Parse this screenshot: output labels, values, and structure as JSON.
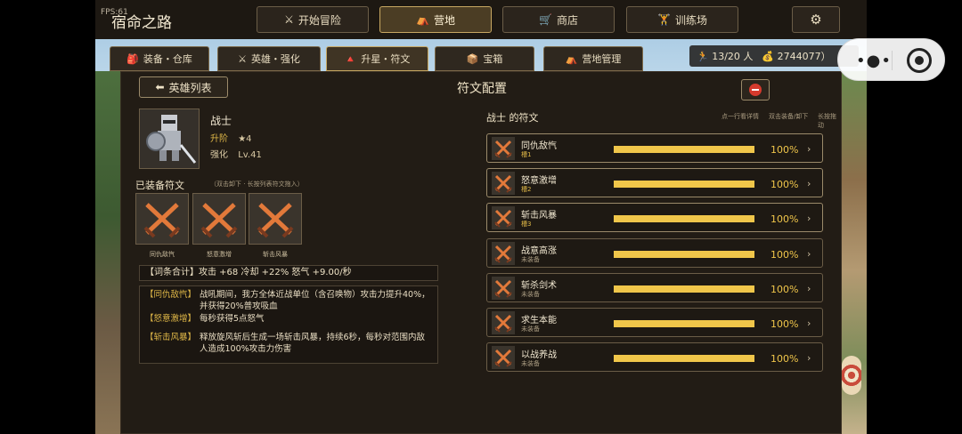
{
  "app": {
    "fps_label": "FPS:61",
    "title": "宿命之路"
  },
  "top_nav": [
    {
      "icon": "⚔",
      "label": "开始冒险",
      "active": false
    },
    {
      "icon": "⛺",
      "label": "营地",
      "active": true
    },
    {
      "icon": "🛒",
      "label": "商店",
      "active": false
    },
    {
      "icon": "🏋",
      "label": "训练场",
      "active": false
    }
  ],
  "settings_icon": "⚙",
  "tabs": [
    {
      "icon": "🎒",
      "label": "装备・仓库"
    },
    {
      "icon": "⚔",
      "label": "英雄・强化"
    },
    {
      "icon": "🔺",
      "label": "升星・符文"
    },
    {
      "icon": "📦",
      "label": "宝箱"
    },
    {
      "icon": "⛺",
      "label": "营地管理"
    }
  ],
  "status": {
    "people": "13/20 人",
    "gold": "2744077）"
  },
  "panel": {
    "back_label": "英雄列表",
    "back_icon": "⬅",
    "title": "符文配置"
  },
  "hero": {
    "name": "战士",
    "rank_key": "升阶",
    "rank_value": "★4",
    "enhance_key": "强化",
    "enhance_value": "Lv.41"
  },
  "equipped": {
    "title": "已装备符文",
    "hint": "（双击卸下 · 长按列表符文拖入）",
    "slots": [
      {
        "label": "同仇敌忾"
      },
      {
        "label": "怒意激增"
      },
      {
        "label": "斩击风暴"
      }
    ]
  },
  "summary": "【词条合计】攻击 +68   冷却 +22%   怒气 +9.00/秒",
  "descriptions": [
    {
      "tag": "【同仇敌忾】",
      "text": "战吼期间，我方全体近战单位（含召唤物）攻击力提升40%，并获得20%普攻吸血"
    },
    {
      "tag": "【怒意激增】",
      "text": "每秒获得5点怒气"
    },
    {
      "tag": "【斩击风暴】",
      "text": "释放旋风斩后生成一场斩击风暴，持续6秒，每秒对范围内敌人造成100%攻击力伤害"
    }
  ],
  "rune_list": {
    "title": "战士 的符文",
    "hints": [
      "点一行看详情",
      "双击装备/卸下",
      "长按拖动"
    ],
    "items": [
      {
        "name": "同仇敌忾",
        "status": "槽1",
        "equipped": true,
        "progress": 1.0,
        "pct": "100%",
        "arrow": "›"
      },
      {
        "name": "怒意激增",
        "status": "槽2",
        "equipped": true,
        "progress": 1.0,
        "pct": "100%",
        "arrow": "›"
      },
      {
        "name": "斩击风暴",
        "status": "槽3",
        "equipped": true,
        "progress": 1.0,
        "pct": "100%",
        "arrow": "›"
      },
      {
        "name": "战意高涨",
        "status": "未装备",
        "equipped": false,
        "progress": 1.0,
        "pct": "100%",
        "arrow": "›"
      },
      {
        "name": "斩杀剑术",
        "status": "未装备",
        "equipped": false,
        "progress": 1.0,
        "pct": "100%",
        "arrow": "›"
      },
      {
        "name": "求生本能",
        "status": "未装备",
        "equipped": false,
        "progress": 1.0,
        "pct": "100%",
        "arrow": "›"
      },
      {
        "name": "以战养战",
        "status": "未装备",
        "equipped": false,
        "progress": 1.0,
        "pct": "100%",
        "arrow": "›"
      }
    ]
  },
  "capsule": {
    "more": "•●•"
  },
  "colors": {
    "accent": "#f0c64a",
    "panel": "#221c15",
    "danger": "#d63a2d"
  }
}
